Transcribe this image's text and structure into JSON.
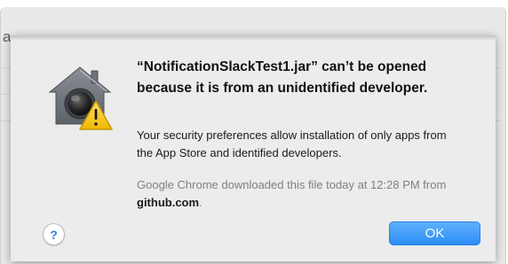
{
  "background_window": {
    "partial_text": "a"
  },
  "alert": {
    "title": "“NotificationSlackTest1.jar” can’t be opened because it is from an unidentified developer.",
    "message": "Your security preferences allow installation of only apps from the App Store and identified developers.",
    "source_prefix": "Google Chrome downloaded this file today at 12:28 PM from ",
    "source_domain": "github.com",
    "source_suffix": ".",
    "help_label": "?",
    "ok_label": "OK",
    "icon": "gatekeeper-warning-icon"
  },
  "colors": {
    "sheet_background": "#ececec",
    "accent_button": "#2c8df6",
    "help_glyph": "#2f7fe6",
    "secondary_text": "#808080",
    "warning_yellow": "#f5c400"
  }
}
